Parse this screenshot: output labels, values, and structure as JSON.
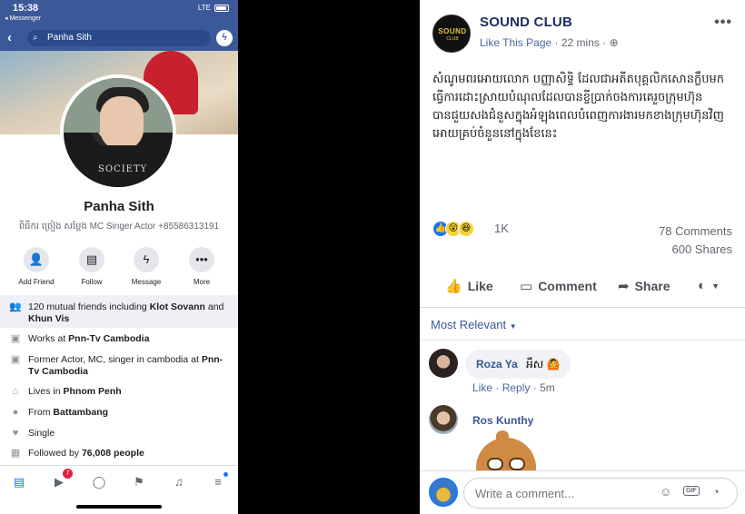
{
  "left": {
    "status": {
      "time": "15:38",
      "back_label": "◂ Messenger",
      "signal": "LTE"
    },
    "search": {
      "query": "Panha Sith"
    },
    "profile": {
      "name": "Panha Sith",
      "bio": "ពិធីករ ច្រៀង សម្ដែង MC Singer Actor +85586313191",
      "shirt_text": "SOCIETY"
    },
    "actions": [
      {
        "label": "Add Friend",
        "icon": "add-friend-icon"
      },
      {
        "label": "Follow",
        "icon": "follow-icon"
      },
      {
        "label": "Message",
        "icon": "messenger-icon"
      },
      {
        "label": "More",
        "icon": "more-icon"
      }
    ],
    "info": {
      "mutual_prefix": "120 mutual friends including ",
      "mutual_name1": "Klot Sovann",
      "mutual_and": " and ",
      "mutual_name2": "Khun Vis",
      "works_prefix": "Works at ",
      "works_place": "Pnn-Tv Cambodia",
      "former_prefix": "Former Actor, MC, singer in cambodia at ",
      "former_place": "Pnn-Tv Cambodia",
      "lives_prefix": "Lives in ",
      "lives_place": "Phnom Penh",
      "from_prefix": "From ",
      "from_place": "Battambang",
      "relationship": "Single",
      "followed_prefix": "Followed by ",
      "followed_count": "76,008 people"
    },
    "tabbar": {
      "video_badge": "7"
    }
  },
  "post": {
    "page_name": "SOUND CLUB",
    "logo_text": "SOUND",
    "logo_sub": "CLUB",
    "like_page": "Like This Page",
    "time_ago": "22 mins",
    "text": "សំណូមពរអោយលោក បញ្ញាសិទ្ធិ ដែលជាអតីតបុគ្គលិកសោនក្លឹបមកធ្វើការដោះស្រាយបំណុលដែលបានខ្ចីប្រាក់ចងការគេរួចក្រុមហ៊ុនបានជួយសងជំនួសក្នុងអំឡុងពេលបំពេញការងារមកខាងក្រុមហ៊ុនវិញអោយគ្រប់ចំនួននៅក្នុងខែនេះ",
    "reaction_count": "1K",
    "comments_count": "78 Comments",
    "shares_count": "600 Shares",
    "like_label": "Like",
    "comment_label": "Comment",
    "share_label": "Share",
    "sort_label": "Most Relevant",
    "comments": [
      {
        "name": "Roza Ya",
        "text": "អឹស 🙆",
        "like": "Like",
        "reply": "Reply",
        "time": "5m"
      },
      {
        "name": "Ros Kunthy"
      }
    ],
    "composer_placeholder": "Write a comment..."
  }
}
